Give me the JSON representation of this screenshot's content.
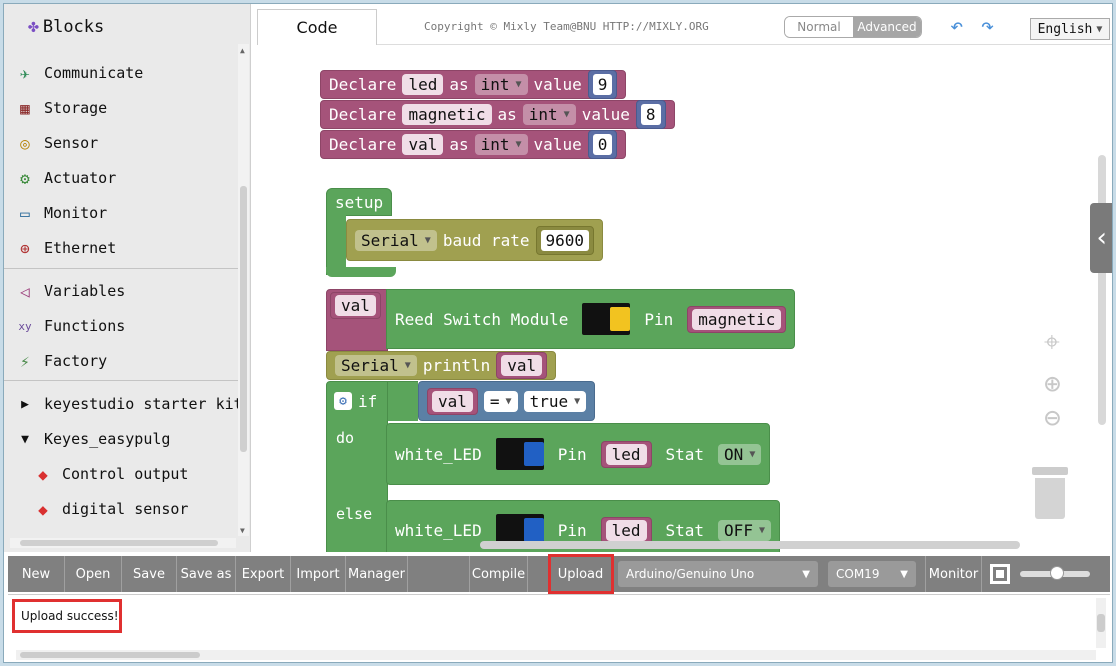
{
  "sidebar": {
    "title": "Blocks",
    "items": [
      {
        "label": "Communicate",
        "icon": "communicate-icon"
      },
      {
        "label": "Storage",
        "icon": "storage-icon"
      },
      {
        "label": "Sensor",
        "icon": "sensor-icon"
      },
      {
        "label": "Actuator",
        "icon": "actuator-icon"
      },
      {
        "label": "Monitor",
        "icon": "monitor-icon"
      },
      {
        "label": "Ethernet",
        "icon": "ethernet-icon"
      },
      {
        "label": "Variables",
        "icon": "variables-icon"
      },
      {
        "label": "Functions",
        "icon": "functions-icon"
      },
      {
        "label": "Factory",
        "icon": "factory-icon"
      },
      {
        "label": "keyestudio starter kit",
        "icon": "expand-arrow-icon"
      },
      {
        "label": "Keyes_easypulg",
        "icon": "collapse-arrow-icon"
      },
      {
        "label": "Control output",
        "icon": "cube-icon"
      },
      {
        "label": "digital sensor",
        "icon": "cube-icon"
      }
    ]
  },
  "header": {
    "tab": "Code",
    "copyright": "Copyright © Mixly Team@BNU HTTP://MIXLY.ORG",
    "mode_normal": "Normal",
    "mode_advanced": "Advanced",
    "language": "English"
  },
  "blocks": {
    "declare": "Declare",
    "as": "as",
    "value": "value",
    "int": "int",
    "var1": "led",
    "val1": "9",
    "var2": "magnetic",
    "val2": "8",
    "var3": "val",
    "val3": "0",
    "setup": "setup",
    "serial": "Serial",
    "baud_rate": "baud rate",
    "baud": "9600",
    "assign_var": "val",
    "reed_switch": "Reed Switch Module",
    "pin": "Pin",
    "reed_pin": "magnetic",
    "println": "println",
    "println_var": "val",
    "if": "if",
    "if_var": "val",
    "eq": "=",
    "true_val": "true",
    "do": "do",
    "else": "else",
    "white_led": "white_LED",
    "led_pin": "led",
    "stat": "Stat",
    "on": "ON",
    "off": "OFF"
  },
  "toolbar": {
    "new": "New",
    "open": "Open",
    "save": "Save",
    "save_as": "Save as",
    "export": "Export",
    "import": "Import",
    "manager": "Manager",
    "compile": "Compile",
    "upload": "Upload",
    "board": "Arduino/Genuino Uno",
    "port": "COM19",
    "monitor": "Monitor"
  },
  "output": {
    "message": "Upload success!"
  },
  "colors": {
    "highlight": "#e03030",
    "variable_block": "#a5537a",
    "logic_block": "#5ba55b"
  }
}
